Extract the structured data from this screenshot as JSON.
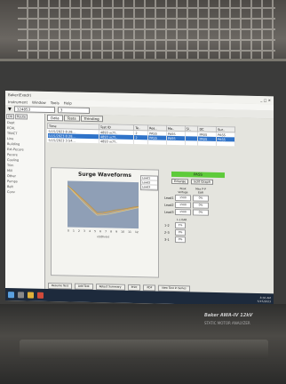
{
  "window": {
    "title": "Baker(Exodr)",
    "controls": "_ □ ✕"
  },
  "menu": [
    "Instrument",
    "Window",
    "Tools",
    "Help"
  ],
  "toolbar": {
    "serial": "124853",
    "count": "3"
  },
  "left_panel": {
    "tabs": [
      "Db",
      "Route"
    ],
    "items": [
      "Dept",
      "ECAL",
      "TRACT",
      "Line",
      "",
      "Building",
      "Ext-Pecore",
      "Pecore",
      "Cooling",
      "Trim",
      "Mill",
      "Other",
      "Pumps",
      "Belt",
      "Conv"
    ]
  },
  "tabs": [
    "Data",
    "Tests",
    "Trending"
  ],
  "table": {
    "headers": [
      "Time",
      "Test ID",
      "Te..",
      "Res..",
      "Mo..",
      "Sl..",
      "DC",
      "Sur.."
    ],
    "rows": [
      [
        "5/15/2023 8:28...",
        "4893 xcTl..",
        "2",
        "PASS",
        "PASS",
        "",
        "PASS",
        "PASS"
      ],
      [
        "5/15/2023 8:28...",
        "4893 xcTl..",
        "2",
        "PASS",
        "PASS",
        "",
        "PASS",
        "PASS"
      ],
      [
        "5/15/2023 3:54...",
        "4893 xcTl..",
        "",
        "",
        "",
        "",
        "",
        ""
      ]
    ],
    "selected_row": 1
  },
  "chart_data": {
    "type": "line",
    "title": "Surge Waveforms",
    "legend": [
      "Lead1",
      "Lead2",
      "Lead3"
    ],
    "x": [
      0,
      1,
      2,
      3,
      4,
      5,
      6,
      7,
      8,
      9,
      10,
      11,
      12
    ],
    "series": [
      {
        "name": "Lead1",
        "values": [
          0.9,
          0.78,
          0.66,
          0.54,
          0.42,
          0.3,
          0.31,
          0.34,
          0.36,
          0.38,
          0.41,
          0.44,
          0.46
        ]
      },
      {
        "name": "Lead2",
        "values": [
          0.9,
          0.76,
          0.63,
          0.5,
          0.38,
          0.27,
          0.28,
          0.3,
          0.33,
          0.36,
          0.39,
          0.42,
          0.45
        ]
      },
      {
        "name": "Lead3",
        "values": [
          0.9,
          0.8,
          0.68,
          0.57,
          0.45,
          0.33,
          0.34,
          0.36,
          0.39,
          0.41,
          0.43,
          0.46,
          0.48
        ]
      }
    ],
    "xlabel": "uS/Div(x)",
    "ylim": [
      0,
      1
    ],
    "grid": false
  },
  "result": {
    "status": "PASS",
    "color": "#5ecb3b"
  },
  "buttons": {
    "enlarge": "Enlarge",
    "edit_graph": "Edit Graph"
  },
  "readings": {
    "col1": "Peak Voltage",
    "col2": "Max P-P EAR",
    "rows": [
      {
        "label": "Lead1",
        "v": "1500",
        "e": "0%"
      },
      {
        "label": "Lead2",
        "v": "1500",
        "e": "0%"
      },
      {
        "label": "Lead3",
        "v": "1500",
        "e": "0%"
      }
    ]
  },
  "lri": {
    "title": "L-L EAR",
    "rows": [
      "1-2",
      "2-3",
      "3-1"
    ],
    "values": [
      "1%",
      "0%",
      "0%"
    ]
  },
  "bottom_buttons": [
    "Resume Test",
    "Add Test",
    "Retest Summary",
    "Print",
    "PDF",
    "New Test in Series"
  ],
  "tray": {
    "time": "8:30 AM",
    "date": "5/15/2023"
  },
  "device": {
    "brand": "Baker AWA-IV 12kV",
    "model": "STATIC MOTOR ANALYZER"
  }
}
